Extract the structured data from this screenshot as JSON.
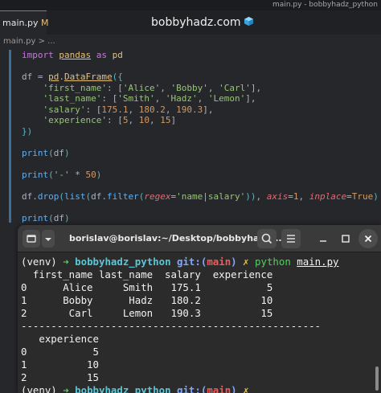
{
  "window": {
    "title": "main.py - bobbyhadz_python"
  },
  "tab": {
    "name": "main.py",
    "modified_marker": "M"
  },
  "brand": {
    "text": "bobbyhadz.com"
  },
  "breadcrumb": {
    "text": "main.py > ..."
  },
  "code": {
    "line1": {
      "import": "import",
      "module": "pandas",
      "as": "as",
      "alias": "pd"
    },
    "line3": {
      "var": "df",
      "eq": " = ",
      "pd": "pd",
      "dot": ".",
      "cls": "DataFrame",
      "open": "({"
    },
    "line4": {
      "key": "'first_name'",
      "colon": ": [",
      "v1": "'Alice'",
      "v2": "'Bobby'",
      "v3": "'Carl'",
      "close": "],"
    },
    "line5": {
      "key": "'last_name'",
      "colon": ": [",
      "v1": "'Smith'",
      "v2": "'Hadz'",
      "v3": "'Lemon'",
      "close": "],"
    },
    "line6": {
      "key": "'salary'",
      "colon": ": [",
      "v1": "175.1",
      "v2": "180.2",
      "v3": "190.3",
      "close": "],"
    },
    "line7": {
      "key": "'experience'",
      "colon": ": [",
      "v1": "5",
      "v2": "10",
      "v3": "15",
      "close": "]"
    },
    "line8": {
      "text": "})"
    },
    "line10": {
      "fn": "print",
      "open": "(",
      "arg": "df",
      "close": ")"
    },
    "line12": {
      "fn": "print",
      "open": "(",
      "str": "'-'",
      "op": " * ",
      "num": "50",
      "close": ")"
    },
    "line14": {
      "obj": "df",
      "dot": ".",
      "method": "drop",
      "open": "(",
      "list": "list",
      "open2": "(",
      "obj2": "df",
      "dot2": ".",
      "filter": "filter",
      "open3": "(",
      "regex": "regex",
      "eq": "=",
      "pattern": "'name|salary'",
      "close3": "))",
      "comma": ", ",
      "axis": "axis",
      "eq2": "=",
      "one": "1",
      "comma2": ", ",
      "inplace": "inplace",
      "eq3": "=",
      "true": "True",
      "close": ")"
    },
    "line16": {
      "fn": "print",
      "open": "(",
      "arg": "df",
      "close": ")"
    }
  },
  "terminal": {
    "title": "borislav@borislav:~/Desktop/bobbyhadz_...",
    "prompt": {
      "venv": "(venv)",
      "arrow": "➜",
      "dir": "bobbyhadz_python",
      "git": "git:(",
      "branch": "main",
      "git_close": ")",
      "dirty": "✗"
    },
    "command": {
      "cmd": "python",
      "arg": "main.py"
    },
    "table1": {
      "header": "  first_name last_name  salary  experience",
      "rows": [
        "0      Alice     Smith   175.1           5",
        "1      Bobby      Hadz   180.2          10",
        "2       Carl     Lemon   190.3          15"
      ]
    },
    "separator": "--------------------------------------------------",
    "table2": {
      "header": "   experience",
      "rows": [
        "0           5",
        "1          10",
        "2          15"
      ]
    }
  },
  "colors": {
    "editor_bg": "#26272b",
    "terminal_bg": "#2b2b2b",
    "prompt_green": "#4fd15b",
    "prompt_cyan": "#58c7d6",
    "prompt_red": "#ef5b5b",
    "prompt_yellow": "#e8c33a"
  }
}
